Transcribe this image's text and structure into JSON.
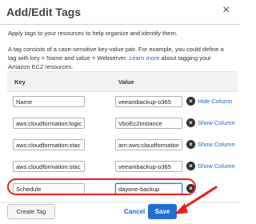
{
  "dialog": {
    "title": "Add/Edit Tags",
    "close_icon": "×",
    "intro": "Apply tags to your resources to help organize and identify them.",
    "info_text": "A tag consists of a case-sensitive key-value pair. For example, you could define a tag with key = Name and value = Webserver.",
    "info_link": "Learn more",
    "info_tail": "about tagging your Amazon EC2 resources."
  },
  "table": {
    "headers": {
      "key": "Key",
      "value": "Value"
    },
    "rows": [
      {
        "key": "Name",
        "value": "veeambackup-o365",
        "action": "Hide Column"
      },
      {
        "key": "aws:cloudformation:logic",
        "value": "VboEc2Instance",
        "action": "Show Column"
      },
      {
        "key": "aws:cloudformation:stac",
        "value": "arn:aws:cloudformation:",
        "action": "Show Column"
      },
      {
        "key": "aws:cloudformation:stac",
        "value": "veeambackup-o365",
        "action": "Show Column"
      },
      {
        "key": "Schedule",
        "value": "dayone-backup",
        "action": ""
      }
    ],
    "delete_icon": "×"
  },
  "footer": {
    "create_label": "Create Tag",
    "cancel_label": "Cancel",
    "save_label": "Save"
  },
  "annotation": {
    "color": "#e2231a"
  }
}
